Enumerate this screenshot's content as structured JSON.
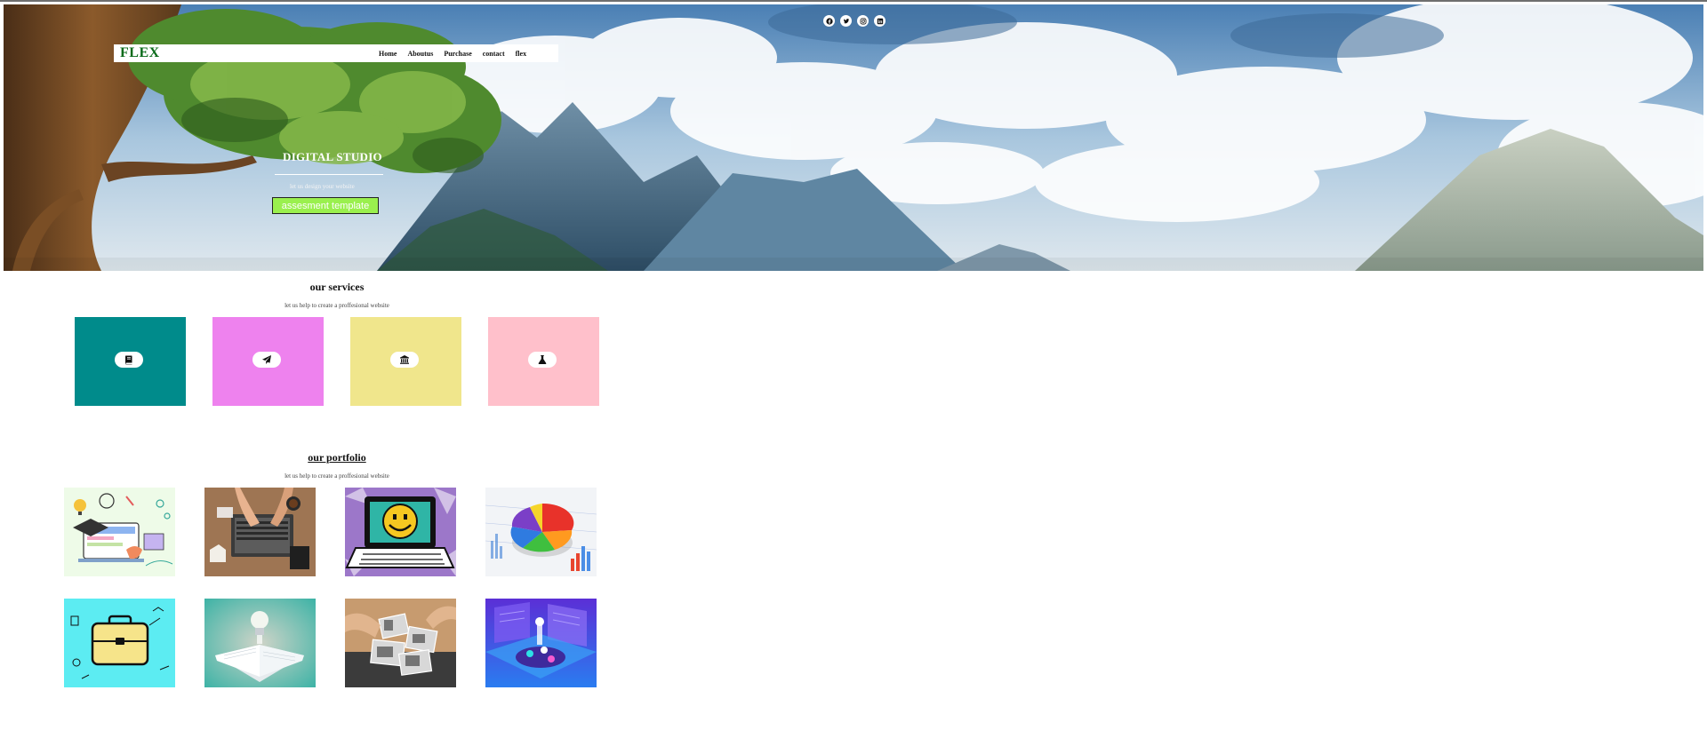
{
  "nav": {
    "brand": "FLEX",
    "links": [
      "Home",
      "Aboutus",
      "Purchase",
      "contact",
      "flex"
    ]
  },
  "social": [
    "facebook-icon",
    "twitter-icon",
    "instagram-icon",
    "linkedin-icon"
  ],
  "hero": {
    "title": "DIGITAL STUDIO",
    "subtitle": "let us design your website",
    "button": "assesment template"
  },
  "services": {
    "title": "our services",
    "subtitle": "let us help to create a proffesional website",
    "cards": [
      {
        "color": "#008b8b",
        "icon": "book-icon"
      },
      {
        "color": "#ee82ee",
        "icon": "paper-plane-icon"
      },
      {
        "color": "#f0e68c",
        "icon": "bank-icon"
      },
      {
        "color": "#ffc0cb",
        "icon": "flask-icon"
      }
    ]
  },
  "portfolio": {
    "title": "our portfolio",
    "subtitle": "let us help to create a proffesional website",
    "items": [
      "online-learning-illustration",
      "laptop-desk-photo",
      "smiley-laptop-illustration",
      "pie-chart-illustration",
      "briefcase-illustration",
      "open-book-lightbulb-illustration",
      "photos-on-table-photo",
      "isometric-workspace-illustration"
    ]
  },
  "colors": {
    "brand": "#0a6b1a",
    "button": "#9af04e"
  }
}
